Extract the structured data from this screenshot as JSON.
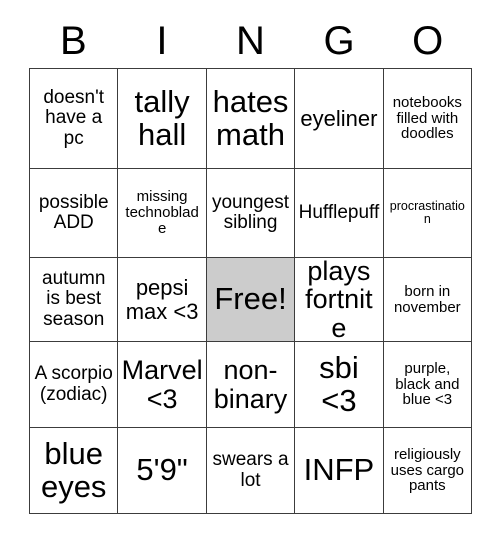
{
  "card": {
    "header_letters": [
      "B",
      "I",
      "N",
      "G",
      "O"
    ],
    "free_space_color": "#cccccc",
    "border_color": "#3c3c3c",
    "background_color": "#ffffff",
    "rows": [
      [
        {
          "text": "doesn't have a pc",
          "size": "md",
          "free": false
        },
        {
          "text": "tally hall",
          "size": "xxl",
          "free": false
        },
        {
          "text": "hates math",
          "size": "xxl",
          "free": false
        },
        {
          "text": "eyeliner",
          "size": "lg",
          "free": false
        },
        {
          "text": "notebooks filled with doodles",
          "size": "sm",
          "free": false
        }
      ],
      [
        {
          "text": "possible ADD",
          "size": "md",
          "free": false
        },
        {
          "text": "missing technoblade",
          "size": "sm",
          "free": false
        },
        {
          "text": "youngest sibling",
          "size": "md",
          "free": false
        },
        {
          "text": "Hufflepuff",
          "size": "md",
          "free": false
        },
        {
          "text": "procrastination",
          "size": "xs",
          "free": false
        }
      ],
      [
        {
          "text": "autumn is best season",
          "size": "md",
          "free": false
        },
        {
          "text": "pepsi max <3",
          "size": "lg",
          "free": false
        },
        {
          "text": "Free!",
          "size": "xxl",
          "free": true
        },
        {
          "text": "plays fortnite",
          "size": "xl",
          "free": false
        },
        {
          "text": "born in november",
          "size": "sm",
          "free": false
        }
      ],
      [
        {
          "text": "A scorpio (zodiac)",
          "size": "md",
          "free": false
        },
        {
          "text": "Marvel <3",
          "size": "xl",
          "free": false
        },
        {
          "text": "non-binary",
          "size": "xl",
          "free": false
        },
        {
          "text": "sbi <3",
          "size": "xxl",
          "free": false
        },
        {
          "text": "purple, black and blue <3",
          "size": "sm",
          "free": false
        }
      ],
      [
        {
          "text": "blue eyes",
          "size": "xxl",
          "free": false
        },
        {
          "text": "5'9\"",
          "size": "xxl",
          "free": false
        },
        {
          "text": "swears a lot",
          "size": "md",
          "free": false
        },
        {
          "text": "INFP",
          "size": "xxl",
          "free": false
        },
        {
          "text": "religiously uses cargo pants",
          "size": "sm",
          "free": false
        }
      ]
    ]
  }
}
